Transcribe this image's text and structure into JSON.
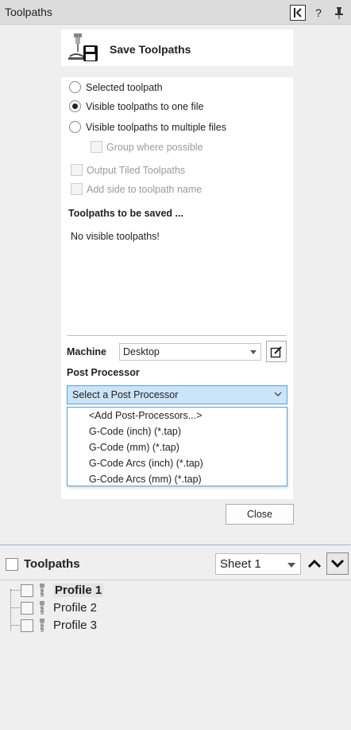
{
  "titlebar": {
    "title": "Toolpaths",
    "help_glyph": "?",
    "icons": [
      "panel-back-icon",
      "help-icon",
      "pin-icon"
    ]
  },
  "header": {
    "title": "Save Toolpaths",
    "icon": "save-toolpaths-icon"
  },
  "options": {
    "radios": [
      {
        "label": "Selected toolpath",
        "checked": false
      },
      {
        "label": "Visible toolpaths to one file",
        "checked": true
      },
      {
        "label": "Visible toolpaths to multiple files",
        "checked": false
      }
    ],
    "group_where_possible": "Group where possible",
    "output_tiled": "Output Tiled Toolpaths",
    "add_side": "Add side to toolpath name"
  },
  "toolpaths_section": {
    "title": "Toolpaths to be saved ...",
    "empty_message": "No visible toolpaths!"
  },
  "machine": {
    "label": "Machine",
    "value": "Desktop"
  },
  "post_processor": {
    "label": "Post Processor",
    "selected": "Select a Post Processor",
    "options": [
      "<Add Post-Processors...>",
      "G-Code (inch) (*.tap)",
      "G-Code (mm) (*.tap)",
      "G-Code Arcs (inch) (*.tap)",
      "G-Code Arcs (mm) (*.tap)"
    ]
  },
  "close_label": "Close",
  "toolpath_list": {
    "title": "Toolpaths",
    "sheet": "Sheet 1",
    "items": [
      {
        "name": "Profile 1",
        "selected": true
      },
      {
        "name": "Profile 2",
        "selected": false
      },
      {
        "name": "Profile 3",
        "selected": false
      }
    ]
  },
  "colors": {
    "dropdown_highlight": "#cce4f7",
    "dropdown_border": "#5c9fd6",
    "panel_background": "#efefef"
  }
}
